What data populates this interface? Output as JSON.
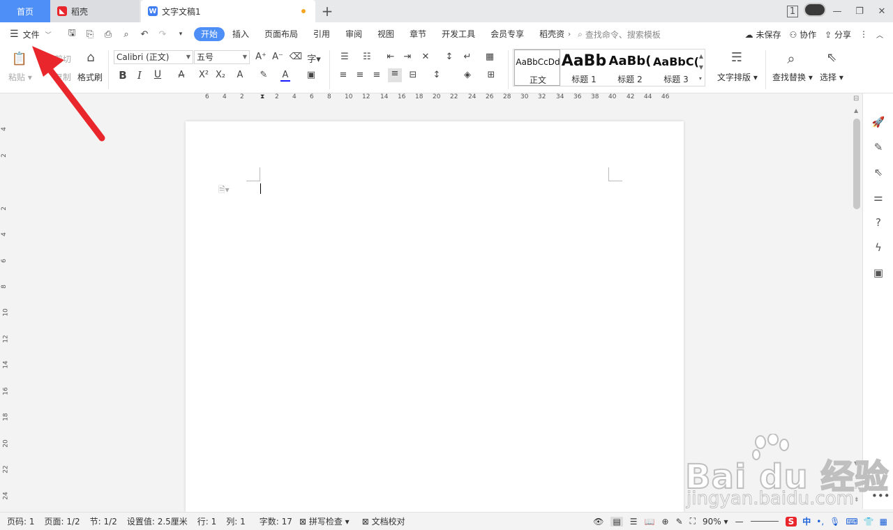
{
  "tabs": {
    "home": "首页",
    "daoke": "稻壳",
    "doc": "文字文稿1",
    "add": "+"
  },
  "window": {
    "page_badge": "1",
    "minimize": "—",
    "restore": "❐",
    "close": "✕"
  },
  "menu": {
    "file": "文件",
    "tabs": [
      "开始",
      "插入",
      "页面布局",
      "引用",
      "审阅",
      "视图",
      "章节",
      "开发工具",
      "会员专享",
      "稻壳资"
    ],
    "search_placeholder": "查找命令、搜索模板",
    "unsaved": "未保存",
    "collab": "协作",
    "share": "分享"
  },
  "ribbon": {
    "paste": "粘贴",
    "cut": "剪切",
    "copy": "复制",
    "format_painter": "格式刷",
    "font_name": "Calibri (正文)",
    "font_size": "五号",
    "bold": "B",
    "italic": "I",
    "underline": "U",
    "styles": [
      {
        "preview": "AaBbCcDd",
        "name": "正文"
      },
      {
        "preview": "AaBb",
        "name": "标题 1"
      },
      {
        "preview": "AaBb(",
        "name": "标题 2"
      },
      {
        "preview": "AaBbC(",
        "name": "标题 3"
      }
    ],
    "text_layout": "文字排版",
    "find_replace": "查找替换",
    "select": "选择"
  },
  "ruler": {
    "h_ticks": [
      "6",
      "4",
      "2",
      "2",
      "4",
      "6",
      "8",
      "10",
      "12",
      "14",
      "16",
      "18",
      "20",
      "22",
      "24",
      "26",
      "28",
      "30",
      "32",
      "34",
      "36",
      "38",
      "40",
      "42",
      "44",
      "46"
    ],
    "v_ticks": [
      "4",
      "2",
      "2",
      "4",
      "6",
      "8",
      "10",
      "12",
      "14",
      "16",
      "18",
      "20",
      "22",
      "24"
    ]
  },
  "status": {
    "page_num": "页码: 1",
    "pages": "页面: 1/2",
    "section": "节: 1/2",
    "setting": "设置值: 2.5厘米",
    "row": "行: 1",
    "col": "列: 1",
    "word_count": "字数: 17",
    "spell_check": "拼写检查",
    "doc_check": "文档校对",
    "zoom": "90%"
  },
  "ime": {
    "logo": "S",
    "lang": "中"
  },
  "watermark": {
    "main": "Bai du 经验",
    "sub": "jingyan.baidu.com"
  },
  "colors": {
    "accent": "#4d8ff7",
    "arrow": "#e8262b"
  }
}
